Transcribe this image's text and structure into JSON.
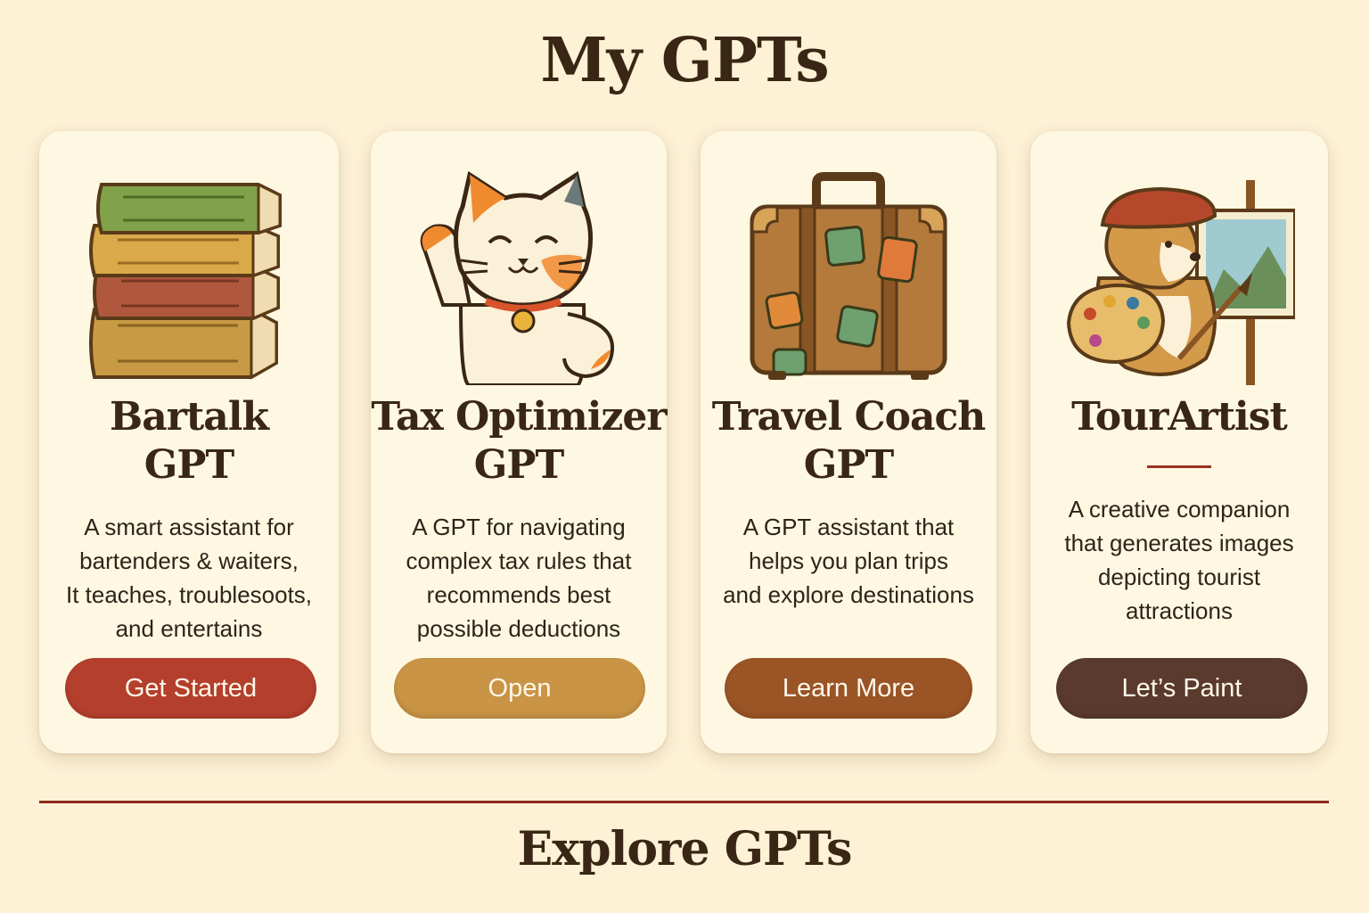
{
  "header": {
    "title": "My GPTs"
  },
  "cards": [
    {
      "title_lines": [
        "Bartalk",
        "GPT"
      ],
      "description_lines": [
        "A smart assistant for",
        "bartenders & waiters,",
        "It teaches, troublesoots,",
        "and entertains"
      ],
      "button_label": "Get Started",
      "button_color": "#b43f2c",
      "icon": "stack-of-books-icon"
    },
    {
      "title_lines": [
        "Tax Optimizer",
        "GPT"
      ],
      "description_lines": [
        "A GPT for navigating",
        "complex tax rules that",
        "recommends best",
        "possible deductions"
      ],
      "button_label": "Open",
      "button_color": "#c99445",
      "icon": "lucky-cat-icon"
    },
    {
      "title_lines": [
        "Travel Coach",
        "GPT"
      ],
      "description_lines": [
        "A GPT assistant that",
        "helps you plan trips",
        "and explore destinations"
      ],
      "button_label": "Learn More",
      "button_color": "#9a5426",
      "icon": "suitcase-icon"
    },
    {
      "title_lines": [
        "TourArtist"
      ],
      "description_lines": [
        "A creative companion",
        "that generates images",
        "depicting tourist",
        "attractions"
      ],
      "button_label": "Let’s Paint",
      "button_color": "#5a3a2c",
      "icon": "painter-dog-icon"
    }
  ],
  "explore": {
    "title": "Explore GPTs"
  },
  "colors": {
    "background": "#fdf1d6",
    "card": "#fef8e3",
    "heading": "#3a2614",
    "divider": "#8a2a1a"
  }
}
